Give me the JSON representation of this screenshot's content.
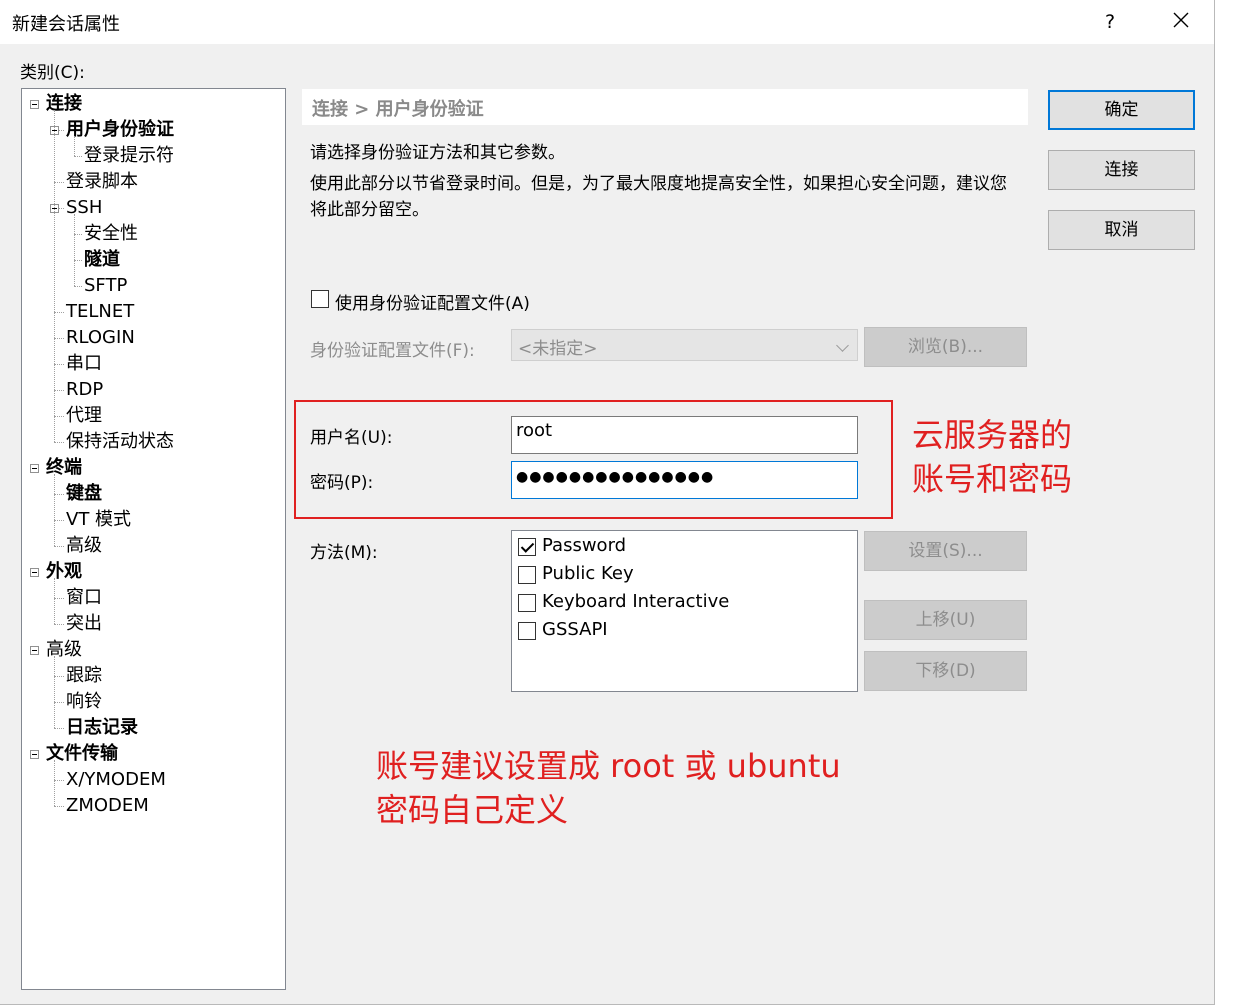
{
  "window": {
    "title": "新建会话属性",
    "help": "?",
    "close_label": "关闭"
  },
  "category_label": "类别(C):",
  "tree": [
    {
      "label": "连接",
      "bold": true,
      "level": 0
    },
    {
      "label": "用户身份验证",
      "bold": true,
      "level": 1,
      "selected": true
    },
    {
      "label": "登录提示符",
      "level": 2
    },
    {
      "label": "登录脚本",
      "level": 1
    },
    {
      "label": "SSH",
      "level": 1
    },
    {
      "label": "安全性",
      "level": 2
    },
    {
      "label": "隧道",
      "bold": true,
      "level": 2
    },
    {
      "label": "SFTP",
      "level": 2
    },
    {
      "label": "TELNET",
      "level": 1
    },
    {
      "label": "RLOGIN",
      "level": 1
    },
    {
      "label": "串口",
      "level": 1
    },
    {
      "label": "RDP",
      "level": 1
    },
    {
      "label": "代理",
      "level": 1
    },
    {
      "label": "保持活动状态",
      "level": 1
    },
    {
      "label": "终端",
      "bold": true,
      "level": 0
    },
    {
      "label": "键盘",
      "bold": true,
      "level": 1
    },
    {
      "label": "VT 模式",
      "level": 1
    },
    {
      "label": "高级",
      "level": 1
    },
    {
      "label": "外观",
      "bold": true,
      "level": 0
    },
    {
      "label": "窗口",
      "level": 1
    },
    {
      "label": "突出",
      "level": 1
    },
    {
      "label": "高级",
      "level": 0
    },
    {
      "label": "跟踪",
      "level": 1
    },
    {
      "label": "响铃",
      "level": 1
    },
    {
      "label": "日志记录",
      "bold": true,
      "level": 1
    },
    {
      "label": "文件传输",
      "bold": true,
      "level": 0
    },
    {
      "label": "X/YMODEM",
      "level": 1
    },
    {
      "label": "ZMODEM",
      "level": 1
    }
  ],
  "breadcrumb": "连接 > 用户身份验证",
  "desc": {
    "line1": "请选择身份验证方法和其它参数。",
    "line2": "使用此部分以节省登录时间。但是，为了最大限度地提高安全性，如果担心安全问题，建议您将此部分留空。"
  },
  "auth_profile": {
    "checkbox_label": "使用身份验证配置文件(A)",
    "checked": false,
    "field_label": "身份验证配置文件(F):",
    "value": "<未指定>",
    "browse_label": "浏览(B)..."
  },
  "username": {
    "label": "用户名(U):",
    "value": "root"
  },
  "password": {
    "label": "密码(P):",
    "value": "●●●●●●●●●●●●●●●"
  },
  "method": {
    "label": "方法(M):",
    "options": [
      {
        "label": "Password",
        "checked": true
      },
      {
        "label": "Public Key",
        "checked": false
      },
      {
        "label": "Keyboard Interactive",
        "checked": false
      },
      {
        "label": "GSSAPI",
        "checked": false
      }
    ],
    "settings_label": "设置(S)...",
    "up_label": "上移(U)",
    "down_label": "下移(D)"
  },
  "buttons": {
    "ok": "确定",
    "connect": "连接",
    "cancel": "取消"
  },
  "annotations": {
    "box_note_line1": "云服务器的",
    "box_note_line2": "账号和密码",
    "bottom_line1": "账号建议设置成 root 或 ubuntu",
    "bottom_line2": "密码自己定义",
    "color": "#e02020"
  }
}
